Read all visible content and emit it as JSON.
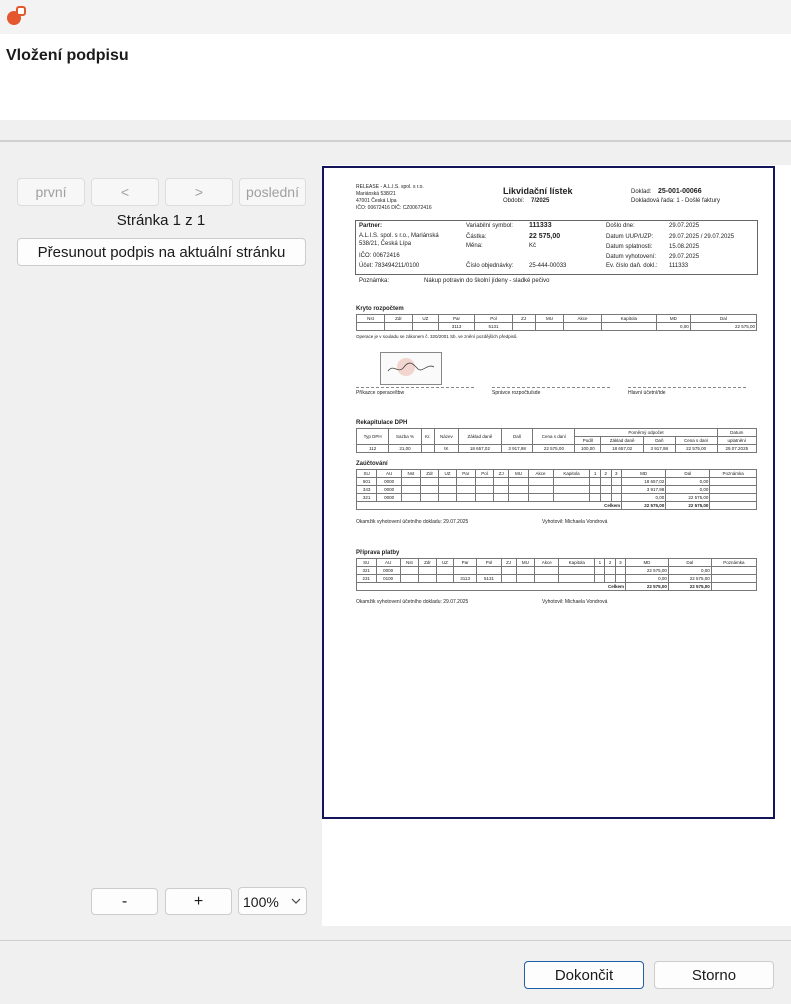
{
  "dialog": {
    "title": "Vložení podpisu"
  },
  "nav": {
    "first": "první",
    "prev": "<",
    "next": ">",
    "last": "poslední",
    "page_label": "Stránka 1 z 1",
    "move_signature": "Přesunout podpis na aktuální stránku"
  },
  "zoom": {
    "minus": "-",
    "plus": "+",
    "value": "100%"
  },
  "footer": {
    "finish": "Dokončit",
    "cancel": "Storno"
  },
  "doc": {
    "company_line1": "RELEASE - A.L.I.S. spol. s r.o.",
    "company_line2": "Mariánská 538/21",
    "company_line3": "47001 Česká Lípa",
    "company_line4": "IČO: 00672416 DIČ: CZ00672416",
    "heading": "Likvidační lístek",
    "period_label": "Období:",
    "period_value": "7/2025",
    "doklad_label": "Doklad:",
    "doklad_value": "25-001-00066",
    "doklad_rada": "Dokladová řada: 1 - Došlé faktury",
    "partner_label": "Partner:",
    "partner_name": "A.L.I.S. spol. s r.o., Mariánská",
    "partner_addr": "538/21, Česká Lípa",
    "partner_ico": "IČO:   00672416",
    "partner_ucet": "Účet:  783494211/0100",
    "vs_label": "Variabilní symbol:",
    "vs_value": "111333",
    "castka_label": "Částka:",
    "castka_value": "22 575,00",
    "mena_label": "Měna:",
    "mena_value": "Kč",
    "objednavka_label": "Číslo objednávky:",
    "objednavka_value": "25-444-00033",
    "doslo_label": "Došlo dne:",
    "doslo_value": "29.07.2025",
    "duup_label": "Datum UUP/UZP:",
    "duup_value": "29.07.2025   /   29.07.2025",
    "splat_label": "Datum splatnosti:",
    "splat_value": "15.08.2025",
    "vyhot_label": "Datum vyhotovení:",
    "vyhot_value": "29.07.2025",
    "evcis_label": "Ev. číslo daň. dokl.:",
    "evcis_value": "111333",
    "pozn_label": "Poznámka:",
    "pozn_value": "Nákup potravin do školní jídeny - sladké pečivo",
    "kryto_title": "Kryto rozpočtem",
    "kryto_headers": [
      "Nst",
      "Zdr",
      "UZ",
      "Par",
      "Pol",
      "ZJ",
      "MU",
      "Akce",
      "Kapitola",
      "MD",
      "Dal"
    ],
    "kryto_row": [
      "",
      "",
      "",
      "3113",
      "5131",
      "",
      "",
      "",
      "",
      "0,00",
      "22 575,00"
    ],
    "operace_text": "Operace je v souladu se zákonem č. 320/2001 Sb. ve znění pozdějších předpisů.",
    "sig1": "Příkazce operace/tbw",
    "sig2": "Správce rozpočtu/sde",
    "sig3": "Hlavní účetní/tde",
    "rekap_title": "Rekapitulace DPH",
    "rekap_headers": [
      "Typ DPH",
      "Sazba %",
      "Kr.",
      "Název",
      "Základ daně",
      "Daň",
      "Cena s daní",
      "Podíl",
      "Základ daně",
      "Daň",
      "Cena s daní",
      "uplatnění"
    ],
    "rekap_row": [
      "112",
      "21,00",
      "",
      "tK",
      "18 657,02",
      "3 917,98",
      "22 575,00",
      "100,00",
      "18 657,02",
      "3 917,98",
      "22 575,00",
      "29.07.2025"
    ],
    "pomerny": "Poměrný odpočet",
    "datum_label": "Datum",
    "zauct_title": "Zaúčtování",
    "zauct_headers": [
      "SU",
      "AU",
      "Nst",
      "Zdr",
      "UZ",
      "Par",
      "Pol",
      "ZJ",
      "MU",
      "Akce",
      "Kapitola",
      "1",
      "2",
      "3",
      "MD",
      "Dal",
      "Poznámka"
    ],
    "zauct_rows": [
      [
        "501",
        "0000",
        "",
        "",
        "",
        "",
        "",
        "",
        "",
        "",
        "",
        "",
        "",
        "",
        "18 657,02",
        "0,00",
        ""
      ],
      [
        "343",
        "0000",
        "",
        "",
        "",
        "",
        "",
        "",
        "",
        "",
        "",
        "",
        "",
        "",
        "3 917,98",
        "0,00",
        ""
      ],
      [
        "321",
        "0000",
        "",
        "",
        "",
        "",
        "",
        "",
        "",
        "",
        "",
        "",
        "",
        "",
        "0,00",
        "22 575,00",
        ""
      ]
    ],
    "celkem": "Celkem",
    "zauct_total_md": "22 575,00",
    "zauct_total_dal": "22 575,00",
    "okamzik1": "Okamžik vyhotovení účetního dokladu: 29.07.2025",
    "vyhotovil1": "Vyhotovil: Michaela Vondrová",
    "priprava_title": "Příprava platby",
    "priprava_rows": [
      [
        "321",
        "0000",
        "",
        "",
        "",
        "",
        "",
        "",
        "",
        "",
        "",
        "",
        "",
        "",
        "22 575,00",
        "0,00",
        ""
      ],
      [
        "231",
        "0100",
        "",
        "",
        "",
        "3113",
        "5131",
        "",
        "",
        "",
        "",
        "",
        "",
        "",
        "0,00",
        "22 575,00",
        ""
      ]
    ],
    "priprava_total_md": "22 575,00",
    "priprava_total_dal": "22 575,00",
    "okamzik2": "Okamžik vyhotovení účetního dokladu: 29.07.2025",
    "vyhotovil2": "Vyhotovil: Michaela Vondrová"
  }
}
